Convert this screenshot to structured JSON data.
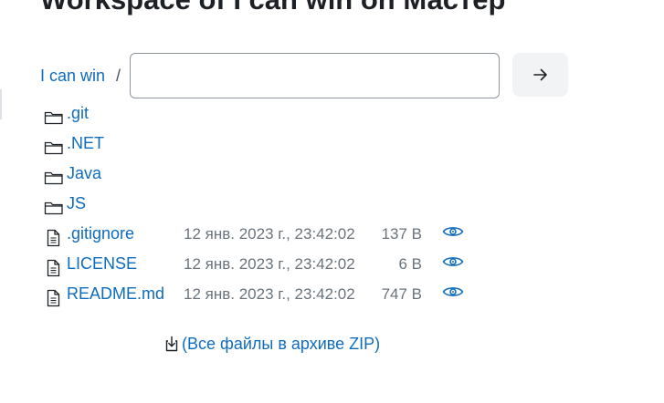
{
  "page": {
    "title": "Workspace of I can win on Мастер"
  },
  "breadcrumb": {
    "root_label": "I can win",
    "separator": "/"
  },
  "path_input": {
    "value": "",
    "placeholder": ""
  },
  "go_button": {
    "icon": "arrow-right-icon"
  },
  "files": [
    {
      "name": ".git",
      "type": "folder",
      "date": "",
      "size": ""
    },
    {
      "name": ".NET",
      "type": "folder",
      "date": "",
      "size": ""
    },
    {
      "name": "Java",
      "type": "folder",
      "date": "",
      "size": ""
    },
    {
      "name": "JS",
      "type": "folder",
      "date": "",
      "size": ""
    },
    {
      "name": ".gitignore",
      "type": "file",
      "date": "12 янв. 2023 г., 23:42:02",
      "size": "137 B"
    },
    {
      "name": "LICENSE",
      "type": "file",
      "date": "12 янв. 2023 г., 23:42:02",
      "size": "6 B"
    },
    {
      "name": "README.md",
      "type": "file",
      "date": "12 янв. 2023 г., 23:42:02",
      "size": "747 B"
    }
  ],
  "zip_download": {
    "label": "(Все файлы в архиве ZIP)",
    "icon": "download-icon"
  },
  "colors": {
    "link": "#0f6cbf",
    "muted_text": "#6a737b",
    "button_bg": "#f2f3f5",
    "title_text": "#1d2125"
  }
}
